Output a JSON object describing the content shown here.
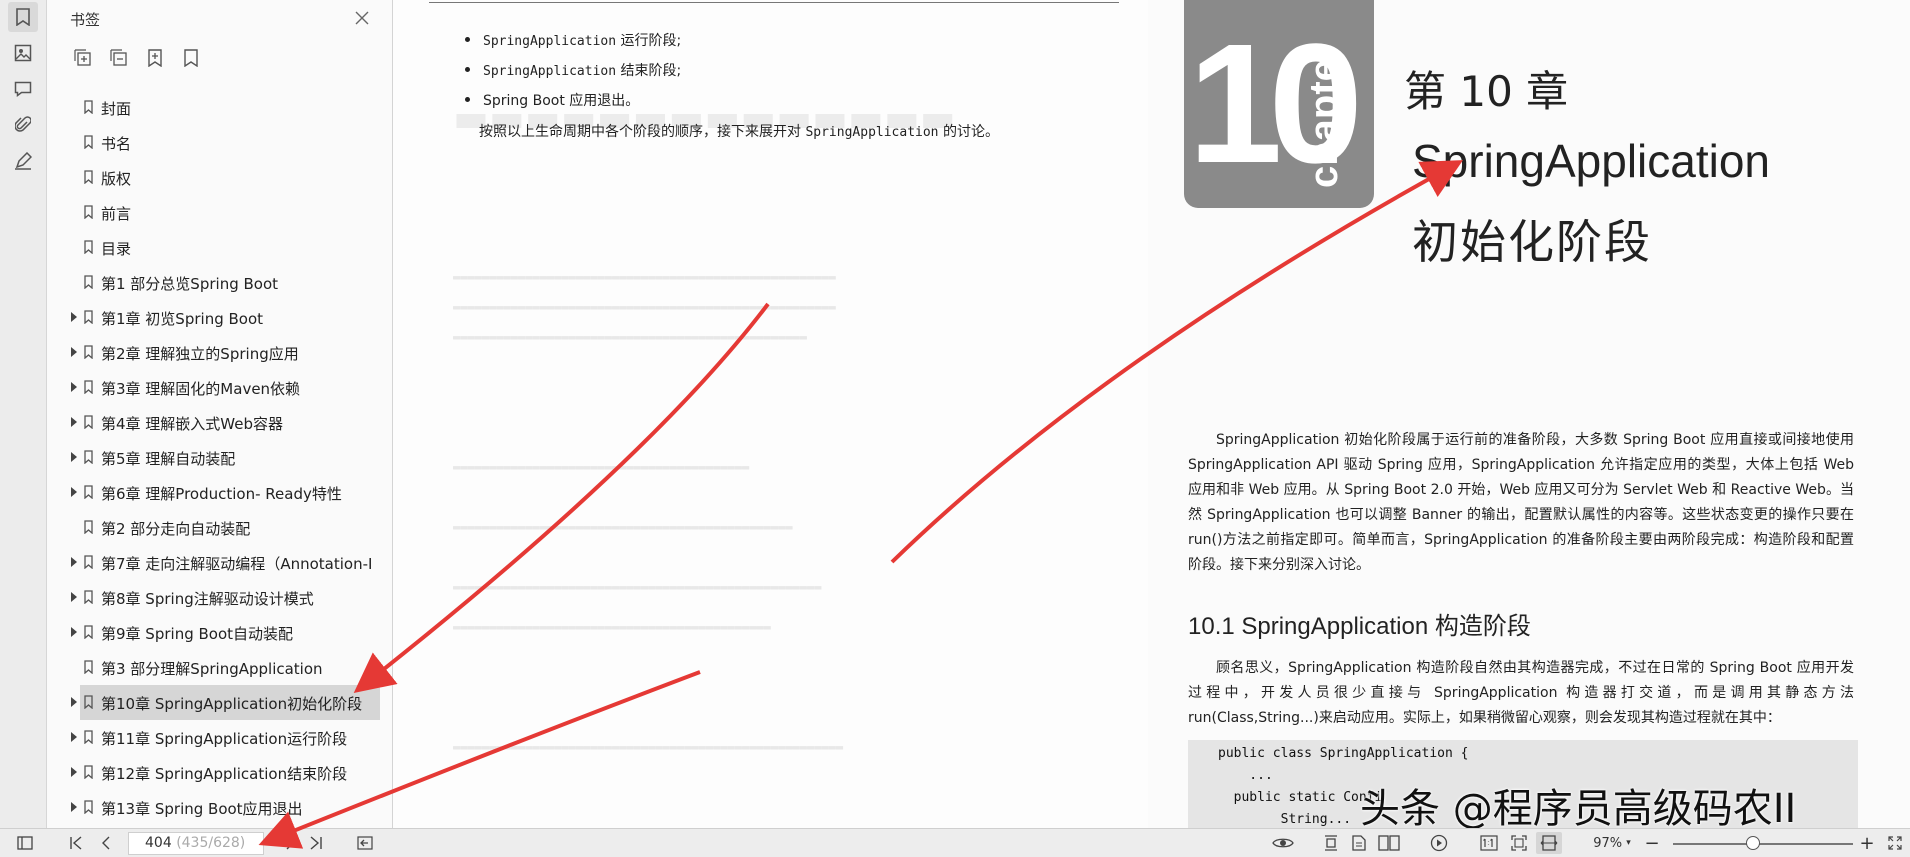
{
  "sidebar": {
    "title": "书签",
    "bookmarks": [
      {
        "label": "封面",
        "expandable": false,
        "selected": false
      },
      {
        "label": "书名",
        "expandable": false,
        "selected": false
      },
      {
        "label": "版权",
        "expandable": false,
        "selected": false
      },
      {
        "label": "前言",
        "expandable": false,
        "selected": false
      },
      {
        "label": "目录",
        "expandable": false,
        "selected": false
      },
      {
        "label": "第1 部分总览Spring Boot",
        "expandable": false,
        "selected": false
      },
      {
        "label": "第1章 初览Spring Boot",
        "expandable": true,
        "selected": false
      },
      {
        "label": "第2章 理解独立的Spring应用",
        "expandable": true,
        "selected": false
      },
      {
        "label": "第3章 理解固化的Maven依赖",
        "expandable": true,
        "selected": false
      },
      {
        "label": "第4章 理解嵌入式Web容器",
        "expandable": true,
        "selected": false
      },
      {
        "label": "第5章 理解自动装配",
        "expandable": true,
        "selected": false
      },
      {
        "label": "第6章 理解Production- Ready特性",
        "expandable": true,
        "selected": false
      },
      {
        "label": "第2 部分走向自动装配",
        "expandable": false,
        "selected": false
      },
      {
        "label": "第7章 走向注解驱动编程（Annotation-I",
        "expandable": true,
        "selected": false
      },
      {
        "label": "第8章 Spring注解驱动设计模式",
        "expandable": true,
        "selected": false
      },
      {
        "label": "第9章 Spring Boot自动装配",
        "expandable": true,
        "selected": false
      },
      {
        "label": "第3 部分理解SpringApplication",
        "expandable": false,
        "selected": false
      },
      {
        "label": "第10章 SpringApplication初始化阶段",
        "expandable": true,
        "selected": true
      },
      {
        "label": "第11章 SpringApplication运行阶段",
        "expandable": true,
        "selected": false
      },
      {
        "label": "第12章 SpringApplication结束阶段",
        "expandable": true,
        "selected": false
      },
      {
        "label": "第13章 Spring Boot应用退出",
        "expandable": true,
        "selected": false
      }
    ]
  },
  "left_page": {
    "lifecycle": [
      {
        "code": "SpringApplication",
        "text": " 运行阶段;"
      },
      {
        "code": "SpringApplication",
        "text": " 结束阶段;"
      },
      {
        "code": "",
        "text": "Spring Boot 应用退出。"
      }
    ],
    "intro_prefix": "按照以上生命周期中各个阶段的顺序，接下来展开对 ",
    "intro_code": "SpringApplication",
    "intro_suffix": " 的讨论。"
  },
  "right_page": {
    "chapter_number": "10",
    "chapter_word": "chapter",
    "chapter_label": "第 10 章",
    "title_line1": "SpringApplication",
    "title_line2": "初始化阶段",
    "paragraph1": "SpringApplication 初始化阶段属于运行前的准备阶段，大多数 Spring Boot 应用直接或间接地使用 SpringApplication API 驱动 Spring 应用，SpringApplication 允许指定应用的类型，大体上包括 Web 应用和非 Web 应用。从 Spring Boot 2.0 开始，Web 应用又可分为 Servlet Web 和 Reactive Web。当然 SpringApplication 也可以调整 Banner 的输出，配置默认属性的内容等。这些状态变更的操作只要在 run()方法之前指定即可。简单而言，SpringApplication 的准备阶段主要由两阶段完成：构造阶段和配置阶段。接下来分别深入讨论。",
    "section_heading": "10.1   SpringApplication 构造阶段",
    "paragraph2": "顾名思义，SpringApplication 构造阶段自然由其构造器完成，不过在日常的 Spring Boot 应用开发过程中，开发人员很少直接与 SpringApplication 构造器打交道，而是调用其静态方法 run(Class,String...)来启动应用。实际上，如果稍微留心观察，则会发现其构造过程就在其中：",
    "code_lines": [
      "public class SpringApplication {",
      "    ...",
      "  public static Confi",
      "        String..."
    ],
    "watermark": "头条 @程序员高级码农II"
  },
  "statusbar": {
    "current_page": "404",
    "page_detail": "(435/628)",
    "zoom": "97%"
  },
  "colors": {
    "accent": "#2f73e8",
    "annotation_arrow": "#e53935",
    "selected_bookmark": "#d6d6d6"
  }
}
